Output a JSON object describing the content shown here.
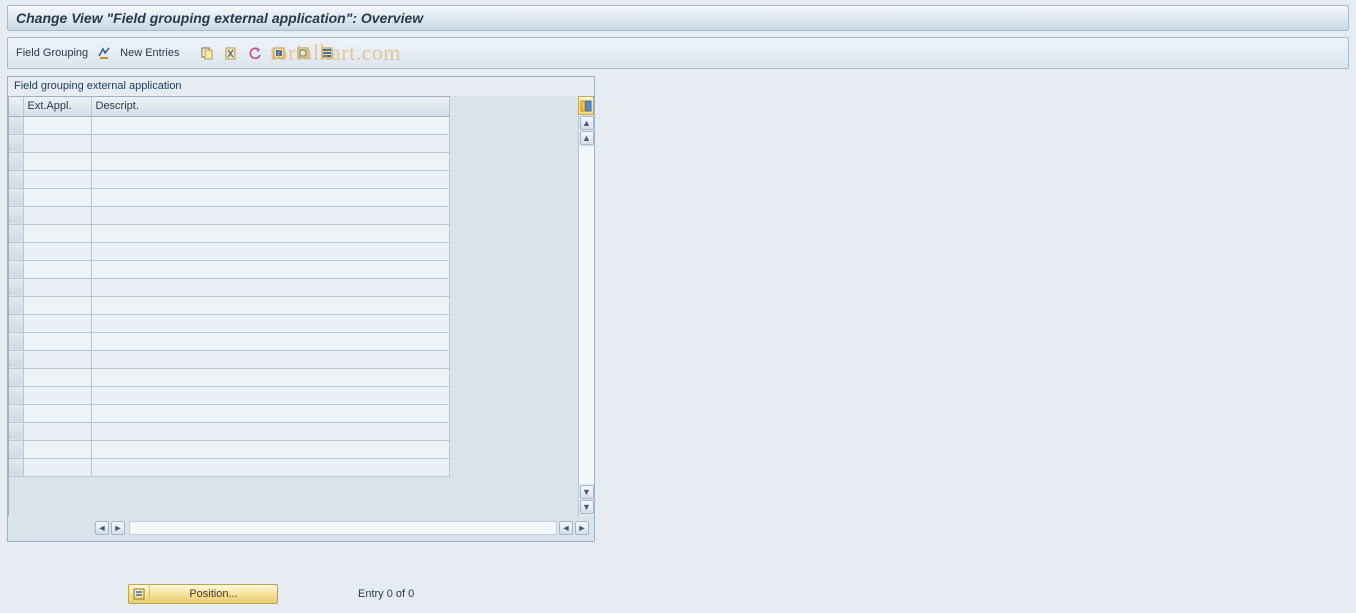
{
  "header": {
    "title": "Change View \"Field grouping external application\": Overview"
  },
  "toolbar": {
    "field_grouping_label": "Field Grouping",
    "new_entries_label": "New Entries"
  },
  "watermark": "torialkart.com",
  "panel": {
    "title": "Field grouping external application",
    "columns": {
      "ext_appl": "Ext.Appl.",
      "descript": "Descript."
    },
    "rows": [
      {
        "ext_appl": "",
        "descript": ""
      },
      {
        "ext_appl": "",
        "descript": ""
      },
      {
        "ext_appl": "",
        "descript": ""
      },
      {
        "ext_appl": "",
        "descript": ""
      },
      {
        "ext_appl": "",
        "descript": ""
      },
      {
        "ext_appl": "",
        "descript": ""
      },
      {
        "ext_appl": "",
        "descript": ""
      },
      {
        "ext_appl": "",
        "descript": ""
      },
      {
        "ext_appl": "",
        "descript": ""
      },
      {
        "ext_appl": "",
        "descript": ""
      },
      {
        "ext_appl": "",
        "descript": ""
      },
      {
        "ext_appl": "",
        "descript": ""
      },
      {
        "ext_appl": "",
        "descript": ""
      },
      {
        "ext_appl": "",
        "descript": ""
      },
      {
        "ext_appl": "",
        "descript": ""
      },
      {
        "ext_appl": "",
        "descript": ""
      },
      {
        "ext_appl": "",
        "descript": ""
      },
      {
        "ext_appl": "",
        "descript": ""
      },
      {
        "ext_appl": "",
        "descript": ""
      },
      {
        "ext_appl": "",
        "descript": ""
      }
    ]
  },
  "footer": {
    "position_label": "Position...",
    "entry_text": "Entry 0 of 0"
  }
}
